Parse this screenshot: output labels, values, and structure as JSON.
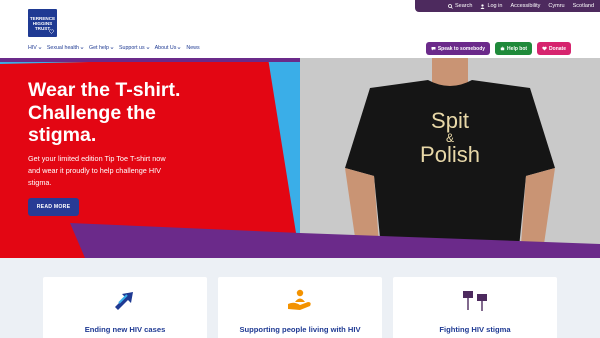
{
  "utility_bar": {
    "search": "Search",
    "login": "Log in",
    "accessibility": "Accessibility",
    "cymru": "Cymru",
    "scotland": "Scotland"
  },
  "logo": {
    "line1": "TERRENCE",
    "line2": "HIGGINS",
    "line3": "TRUST"
  },
  "nav": {
    "items": [
      "HIV",
      "Sexual health",
      "Get help",
      "Support us",
      "About Us",
      "News"
    ]
  },
  "actions": {
    "speak": "Speak to somebody",
    "help_bot": "Help bot",
    "donate": "Donate"
  },
  "hero": {
    "title_line1": "Wear the T-shirt.",
    "title_line2": "Challenge the",
    "title_line3": "stigma.",
    "text_line1": "Get your limited edition Tip Toe T-shirt now",
    "text_line2": "and wear it proudly to help challenge HIV",
    "text_line3": "stigma.",
    "button": "READ MORE",
    "shirt_line1": "Spit",
    "shirt_amp": "&",
    "shirt_line2": "Polish"
  },
  "cards": [
    {
      "title": "Ending new HIV cases",
      "icon": "arrows-up-right-icon"
    },
    {
      "title": "Supporting people living with HIV",
      "icon": "hand-person-icon"
    },
    {
      "title": "Fighting HIV stigma",
      "icon": "protest-signs-icon"
    }
  ],
  "colors": {
    "brand_blue": "#1f3a93",
    "purple": "#6b2a8a",
    "red": "#e30613",
    "sky": "#3aaee8",
    "orange": "#f39200"
  }
}
